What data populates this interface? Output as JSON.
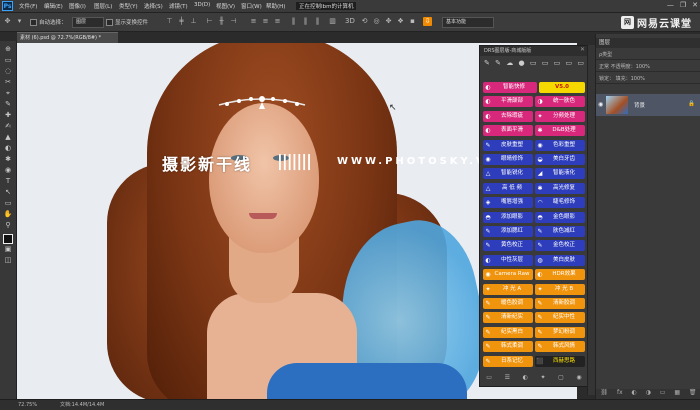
{
  "app": {
    "logo": "Ps"
  },
  "menu": [
    "文件(F)",
    "编辑(E)",
    "图像(I)",
    "图层(L)",
    "类型(Y)",
    "选择(S)",
    "滤镜(T)",
    "3D(D)",
    "视图(V)",
    "窗口(W)",
    "帮助(H)",
    "正在控制Ibm的计算机"
  ],
  "window_controls": {
    "minimize": "—",
    "restore": "❐",
    "close": "✕"
  },
  "options_bar": {
    "auto_select_label": "自动选择：",
    "auto_select_value": "图层",
    "transform_label": "显示变换控件",
    "workspace_value": "基本功能"
  },
  "brand": {
    "mark": "网",
    "text": "网易云课堂"
  },
  "document": {
    "tab": "素材 (6).psd @ 72.7%(RGB/8#) *"
  },
  "watermark": {
    "text": "摄影新干线",
    "bars": "|||||||",
    "url": "WWW.PHOTOSKY.VIP"
  },
  "drs_panel": {
    "title": "DRS图层版-商城版版",
    "close": "✕",
    "top_icons": [
      "✎",
      "✎",
      "☁",
      "●",
      "▭",
      "▭",
      "▭",
      "▭",
      "▭"
    ],
    "rows": [
      [
        {
          "label": "智能快修",
          "icon": "◐",
          "color": "pink"
        },
        {
          "label": "V5.0",
          "icon": "",
          "color": "yellow"
        }
      ],
      [
        {
          "label": "平滑颠部",
          "icon": "◐",
          "color": "pink"
        },
        {
          "label": "统一肤色",
          "icon": "◑",
          "color": "pink"
        }
      ],
      [
        {
          "label": "去除瑕疵",
          "icon": "◐",
          "color": "pink"
        },
        {
          "label": "分频处理",
          "icon": "✦",
          "color": "pink"
        }
      ],
      [
        {
          "label": "表面平滑",
          "icon": "◐",
          "color": "pink"
        },
        {
          "label": "D&B处理",
          "icon": "✱",
          "color": "pink"
        }
      ],
      [
        {
          "label": "皮肤重塑",
          "icon": "✎",
          "color": "blue"
        },
        {
          "label": "色彩重塑",
          "icon": "◉",
          "color": "blue"
        }
      ],
      [
        {
          "label": "眼睛修饰",
          "icon": "◉",
          "color": "blue"
        },
        {
          "label": "美白牙齿",
          "icon": "◒",
          "color": "blue"
        }
      ],
      [
        {
          "label": "智能锐化",
          "icon": "△",
          "color": "blue"
        },
        {
          "label": "智能液化",
          "icon": "◢",
          "color": "blue"
        }
      ],
      [
        {
          "label": "高 低 频",
          "icon": "△",
          "color": "blue"
        },
        {
          "label": "高光修复",
          "icon": "✱",
          "color": "blue"
        }
      ],
      [
        {
          "label": "嘴唇增强",
          "icon": "◈",
          "color": "blue"
        },
        {
          "label": "睫毛修饰",
          "icon": "◠",
          "color": "blue"
        }
      ],
      [
        {
          "label": "添加眼影",
          "icon": "◓",
          "color": "blue"
        },
        {
          "label": "金色眼影",
          "icon": "◓",
          "color": "blue"
        }
      ],
      [
        {
          "label": "添加腮红",
          "icon": "✎",
          "color": "blue"
        },
        {
          "label": "肤色减红",
          "icon": "✎",
          "color": "blue"
        }
      ],
      [
        {
          "label": "黄色校正",
          "icon": "✎",
          "color": "blue"
        },
        {
          "label": "金色校正",
          "icon": "✎",
          "color": "blue"
        }
      ],
      [
        {
          "label": "中性灰层",
          "icon": "◐",
          "color": "blue"
        },
        {
          "label": "美白皮肤",
          "icon": "◍",
          "color": "blue"
        }
      ],
      [
        {
          "label": "Camera Raw",
          "icon": "◉",
          "color": "orange"
        },
        {
          "label": "HDR效果",
          "icon": "◐",
          "color": "orange"
        }
      ],
      [
        {
          "label": "冲 光 A",
          "icon": "✦",
          "color": "orange"
        },
        {
          "label": "冲 光 B",
          "icon": "✦",
          "color": "orange"
        }
      ],
      [
        {
          "label": "暖色胶调",
          "icon": "✎",
          "color": "orange"
        },
        {
          "label": "清新胶调",
          "icon": "✎",
          "color": "orange"
        }
      ],
      [
        {
          "label": "清新纪实",
          "icon": "✎",
          "color": "orange"
        },
        {
          "label": "纪实中性",
          "icon": "✎",
          "color": "orange"
        }
      ],
      [
        {
          "label": "纪实黑白",
          "icon": "✎",
          "color": "orange"
        },
        {
          "label": "梦幻粉调",
          "icon": "✎",
          "color": "orange"
        }
      ],
      [
        {
          "label": "韩式柔调",
          "icon": "✎",
          "color": "orange"
        },
        {
          "label": "韩式风情",
          "icon": "✎",
          "color": "orange"
        }
      ],
      [
        {
          "label": "日系记忆",
          "icon": "✎",
          "color": "orange"
        },
        {
          "label": "西赫思路",
          "icon": "⬛",
          "color": "dark"
        }
      ]
    ],
    "footer_icons": [
      "▭",
      "☰",
      "◐",
      "✦",
      "▢",
      "◉"
    ]
  },
  "layers_panel": {
    "tab": "图层",
    "rows": [
      "ρ类型",
      "正常  不透明度：100%",
      "锁定：  填充：100%"
    ],
    "layer_name": "背景",
    "eye": "◉",
    "lock": "🔒",
    "footer_icons": [
      "⛓",
      "fx",
      "◐",
      "◑",
      "▭",
      "▦",
      "🗑"
    ]
  },
  "status": {
    "zoom": "72.75%",
    "doc": "文档:14.4M/14.4M"
  },
  "tools": [
    "⊕",
    "▭",
    "◌",
    "✂",
    "⌖",
    "✎",
    "✚",
    "✍",
    "▲",
    "◐",
    "✱",
    "◉",
    "T",
    "↖",
    "▭",
    "✋",
    "⚲",
    "◧",
    "▣",
    "◫"
  ]
}
